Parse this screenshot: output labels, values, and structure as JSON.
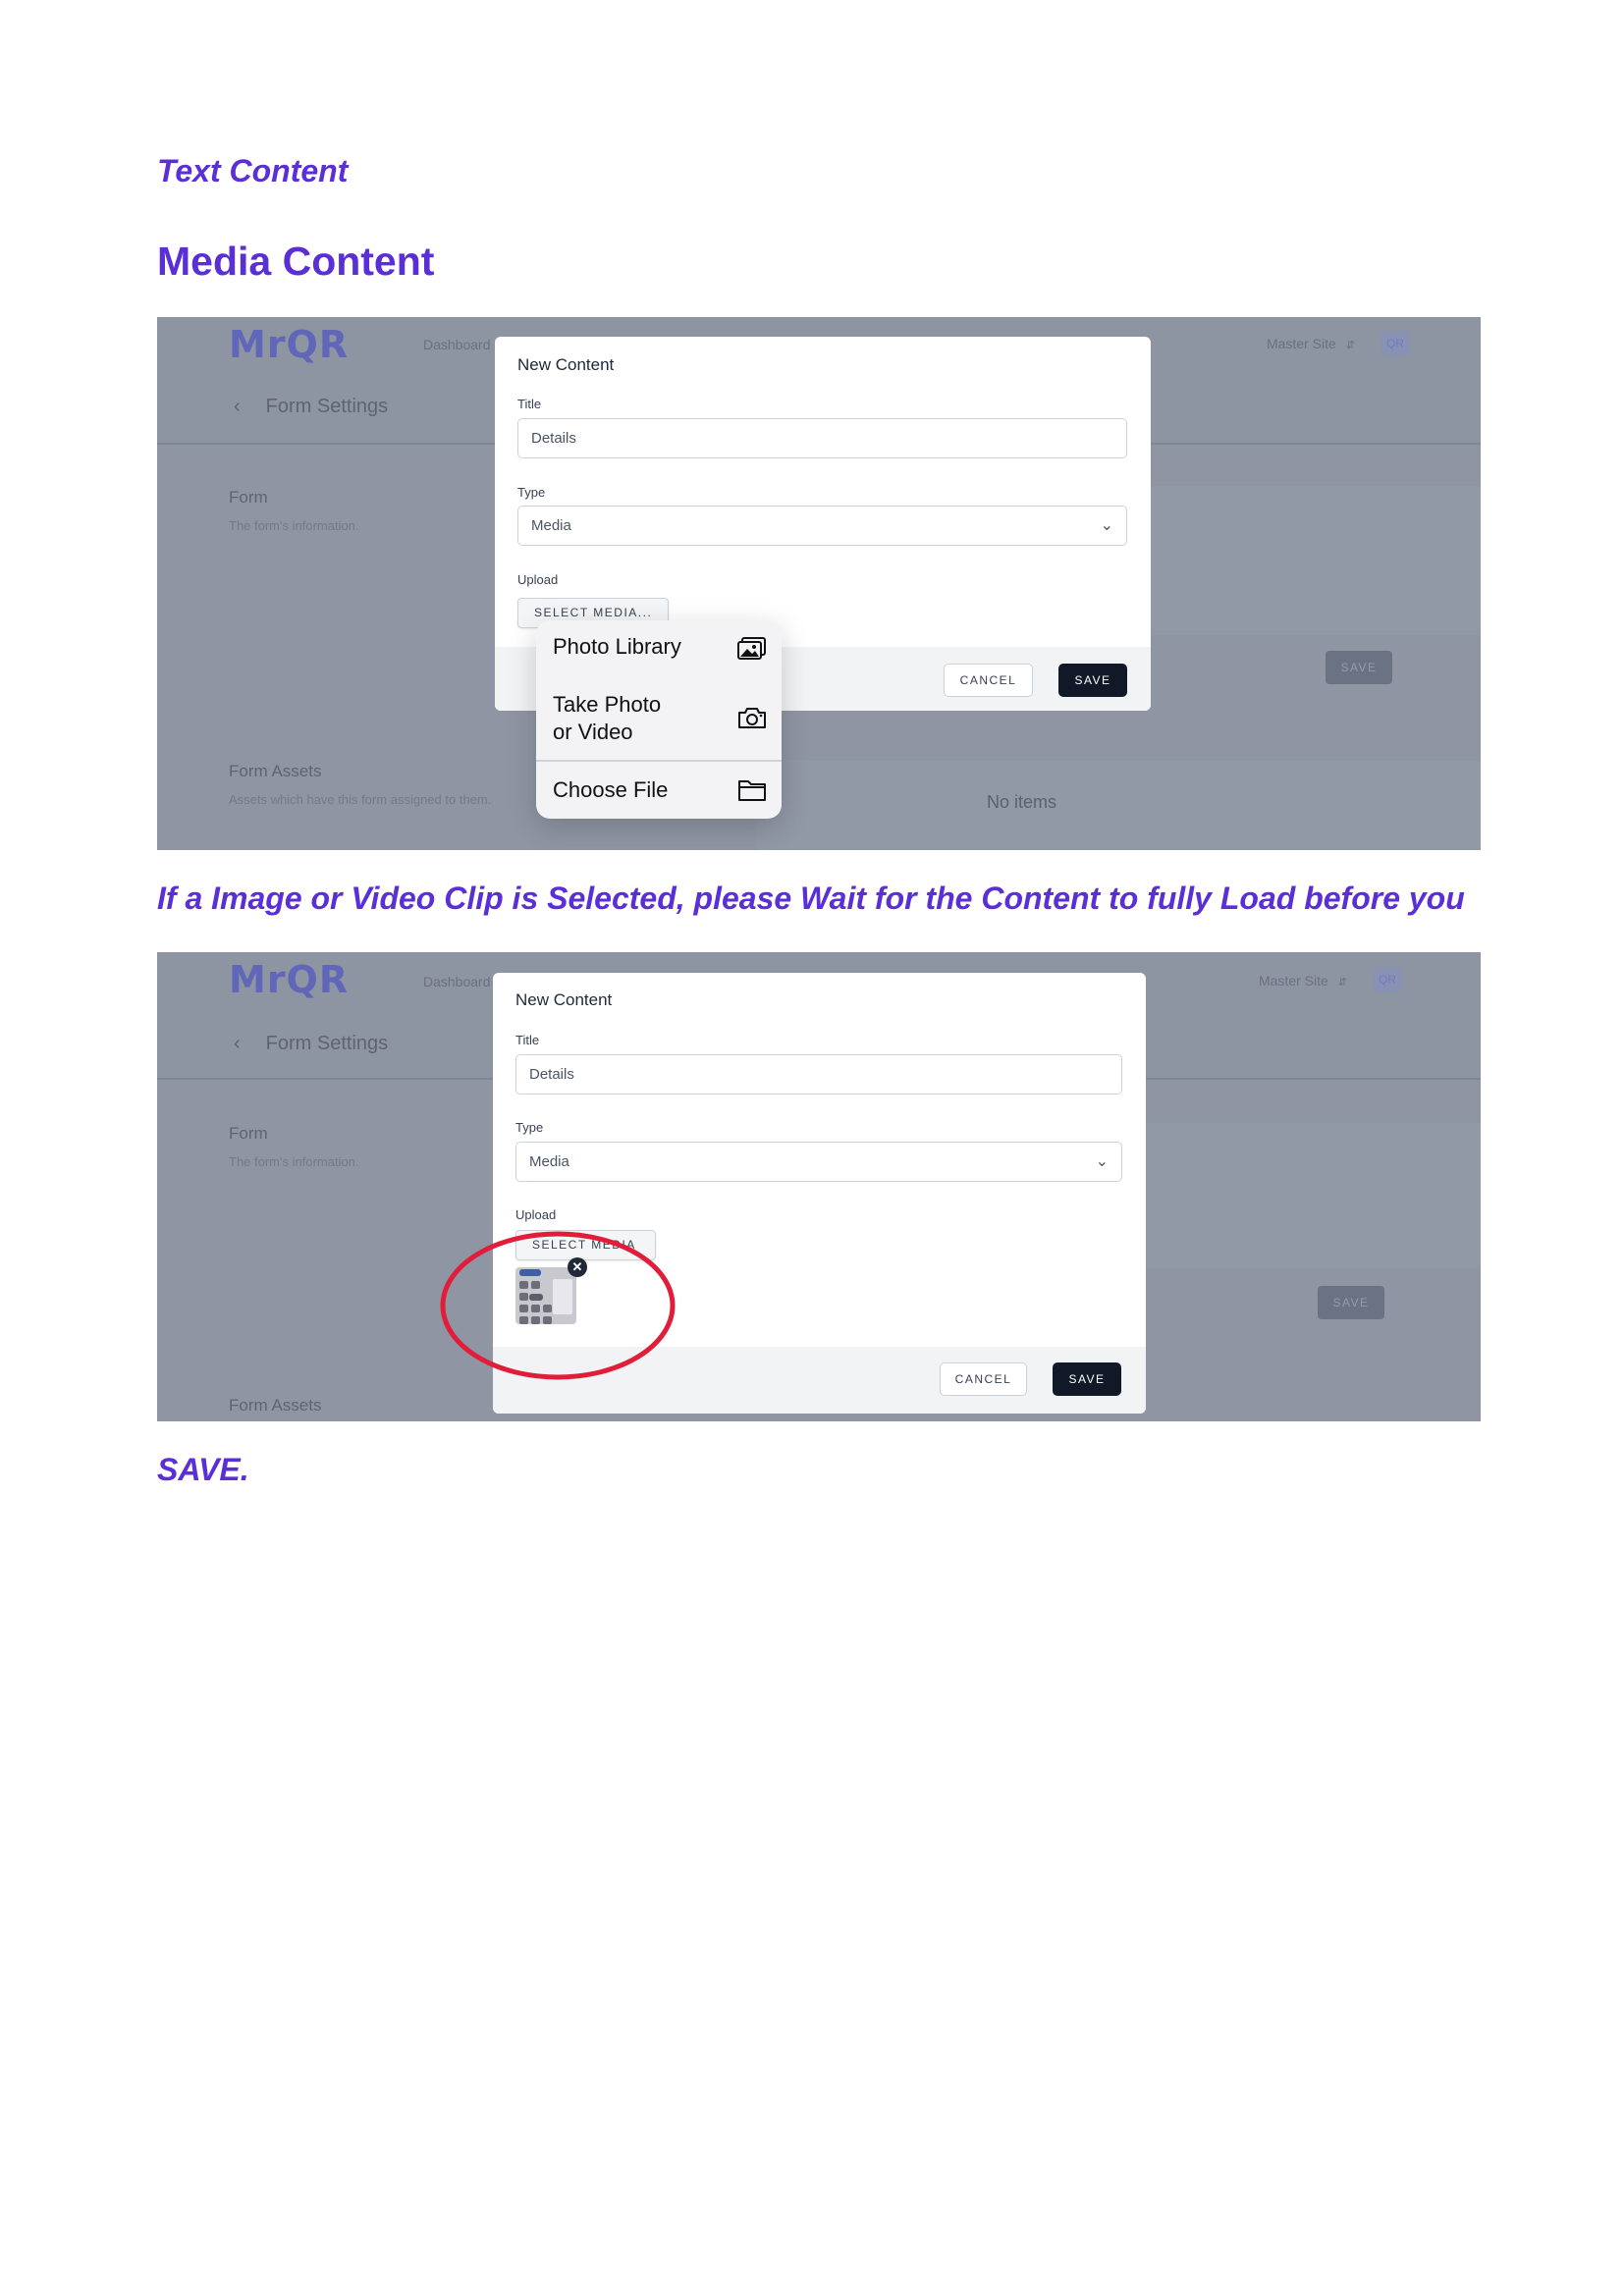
{
  "document": {
    "heading_text_content": "Text Content",
    "heading_media_content": "Media Content",
    "instruction": "If a Image or Video Clip is Selected, please Wait for the Content to fully Load before you",
    "final_step": "SAVE."
  },
  "app": {
    "logo": "MrQR",
    "nav_dashboard": "Dashboard",
    "site_selector": "Master Site",
    "user_badge": "QR",
    "back_title": "Form Settings",
    "form_section_title": "Form",
    "form_section_subtitle": "The form's information.",
    "assets_section_title": "Form Assets",
    "assets_section_subtitle": "Assets which have this form assigned to them.",
    "background_save": "SAVE",
    "no_items": "No items"
  },
  "modal": {
    "title": "New Content",
    "title_label": "Title",
    "title_value": "Details",
    "type_label": "Type",
    "type_value": "Media",
    "upload_label": "Upload",
    "select_media_truncated": "SELECT MEDIA...",
    "select_media_overlapped": "SELECT MEDIA",
    "cancel": "CANCEL",
    "save": "SAVE"
  },
  "media_picker": {
    "items": [
      {
        "label": "Photo Library",
        "icon": "photo-library-icon"
      },
      {
        "label": "Take Photo\nor Video",
        "icon": "camera-icon"
      },
      {
        "label": "Choose File",
        "icon": "folder-icon"
      }
    ]
  },
  "colors": {
    "heading": "#5b2fd6",
    "overlay": "#8f95a3",
    "primary_button": "#111827",
    "annotation": "#e11d3a"
  }
}
